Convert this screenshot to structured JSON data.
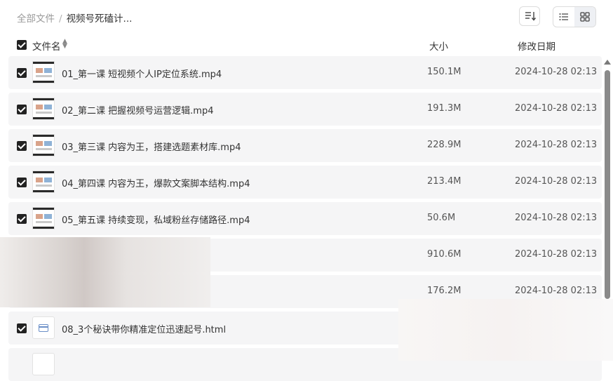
{
  "breadcrumb": {
    "root": "全部文件",
    "separator": "/",
    "current": "视频号死磕计..."
  },
  "toolbar": {
    "sort_icon": "sort-icon",
    "list_icon": "list-view-icon",
    "grid_icon": "grid-view-icon"
  },
  "header": {
    "name": "文件名",
    "size": "大小",
    "date": "修改日期"
  },
  "files": [
    {
      "name": "01_第一课 短视频个人IP定位系统.mp4",
      "size": "150.1M",
      "date": "2024-10-28 02:13",
      "type": "video"
    },
    {
      "name": "02_第二课 把握视频号运营逻辑.mp4",
      "size": "191.3M",
      "date": "2024-10-28 02:13",
      "type": "video"
    },
    {
      "name": "03_第三课 内容为王，搭建选题素材库.mp4",
      "size": "228.9M",
      "date": "2024-10-28 02:13",
      "type": "video"
    },
    {
      "name": "04_第四课 内容为王，爆款文案脚本结构.mp4",
      "size": "213.4M",
      "date": "2024-10-28 02:13",
      "type": "video"
    },
    {
      "name": "05_第五课 持续变现，私域粉丝存储路径.mp4",
      "size": "50.6M",
      "date": "2024-10-28 02:13",
      "type": "video"
    },
    {
      "name": "",
      "size": "910.6M",
      "date": "2024-10-28 02:13",
      "type": "hidden"
    },
    {
      "name": "",
      "size": "176.2M",
      "date": "2024-10-28 02:13",
      "type": "hidden"
    },
    {
      "name": "08_3个秘诀带你精准定位迅速起号.html",
      "size": "",
      "date": "",
      "type": "html"
    }
  ]
}
